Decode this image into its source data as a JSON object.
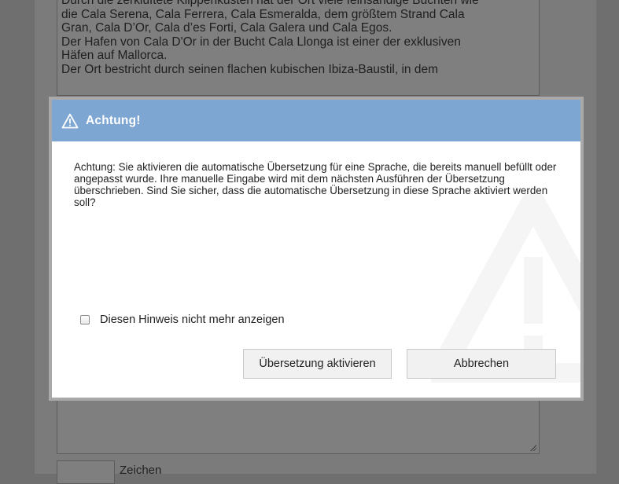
{
  "background": {
    "text_lines": [
      "Durch die zerklüftete Klippenküsten hat der Ort viele feinsandige Buchten wie",
      "die Cala Serena, Cala Ferrera, Cala Esmeralda, dem größtem Strand Cala",
      "Gran, Cala D’Or, Cala d’es Forti, Cala Galera und Cala Egos.",
      "Der Hafen von Cala D'Or in der Bucht Cala Llonga ist einer der exklusiven",
      "Häfen auf Mallorca.",
      "Der Ort bestricht durch seinen flachen kubischen Ibiza-Baustil, in dem"
    ],
    "counter_label": "Zeichen"
  },
  "dialog": {
    "title": "Achtung!",
    "title_icon": "warning-triangle-icon",
    "watermark_icon": "warning-triangle-icon",
    "body": "Achtung: Sie aktivieren die automatische Übersetzung für eine Sprache, die bereits manuell befüllt oder angepasst wurde. Ihre manuelle Eingabe wird mit dem nächsten Ausführen der Übersetzung überschrieben. Sind Sie sicher, dass die automatische Übersetzung in diese Sprache aktiviert werden soll?",
    "checkbox_label": "Diesen Hinweis nicht mehr anzeigen",
    "checkbox_checked": false,
    "activate_label": "Übersetzung aktivieren",
    "cancel_label": "Abbrechen",
    "header_color": "#7ea6d3"
  }
}
